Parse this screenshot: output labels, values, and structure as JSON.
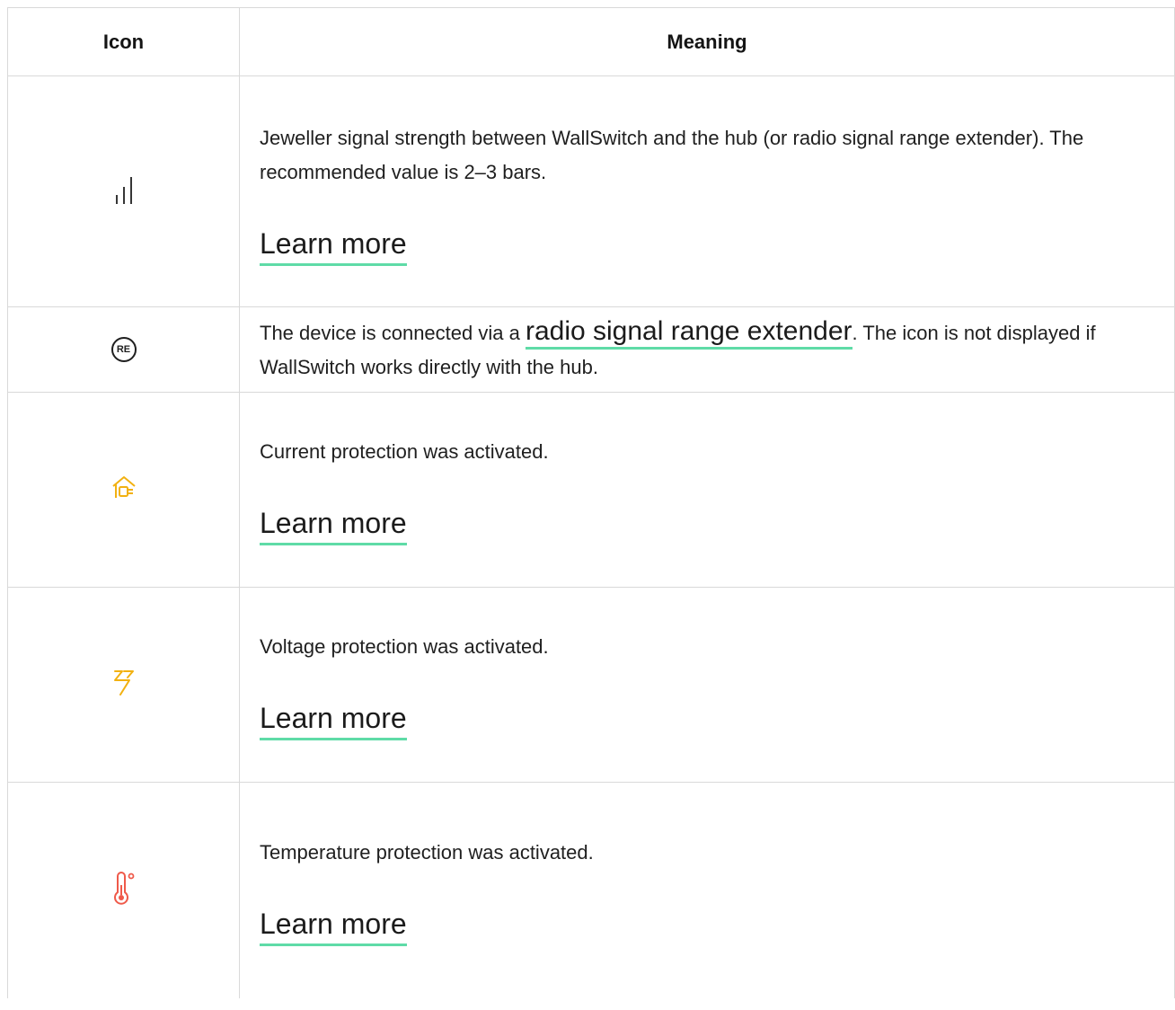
{
  "table": {
    "headers": {
      "icon": "Icon",
      "meaning": "Meaning"
    },
    "rows": [
      {
        "icon": "signal-strength-icon",
        "meaning": "Jeweller signal strength between WallSwitch and the hub (or radio signal range extender). The recommended value is 2–3 bars.",
        "link": "Learn more"
      },
      {
        "icon": "range-extender-icon",
        "icon_text": "RE",
        "meaning_before": "The device is connected via a ",
        "meaning_link": "radio signal range extender",
        "meaning_after": ". The icon is not displayed if WallSwitch works directly with the hub."
      },
      {
        "icon": "current-protection-icon",
        "icon_color": "#f2b111",
        "meaning": "Current protection was activated.",
        "link": "Learn more"
      },
      {
        "icon": "voltage-protection-icon",
        "icon_color": "#f2b111",
        "meaning": "Voltage protection was activated.",
        "link": "Learn more"
      },
      {
        "icon": "temperature-protection-icon",
        "icon_color": "#ef5a4a",
        "meaning": "Temperature protection was activated.",
        "link": "Learn more"
      }
    ]
  },
  "colors": {
    "link_underline": "#5fdba7",
    "border": "#d9d9d9"
  }
}
